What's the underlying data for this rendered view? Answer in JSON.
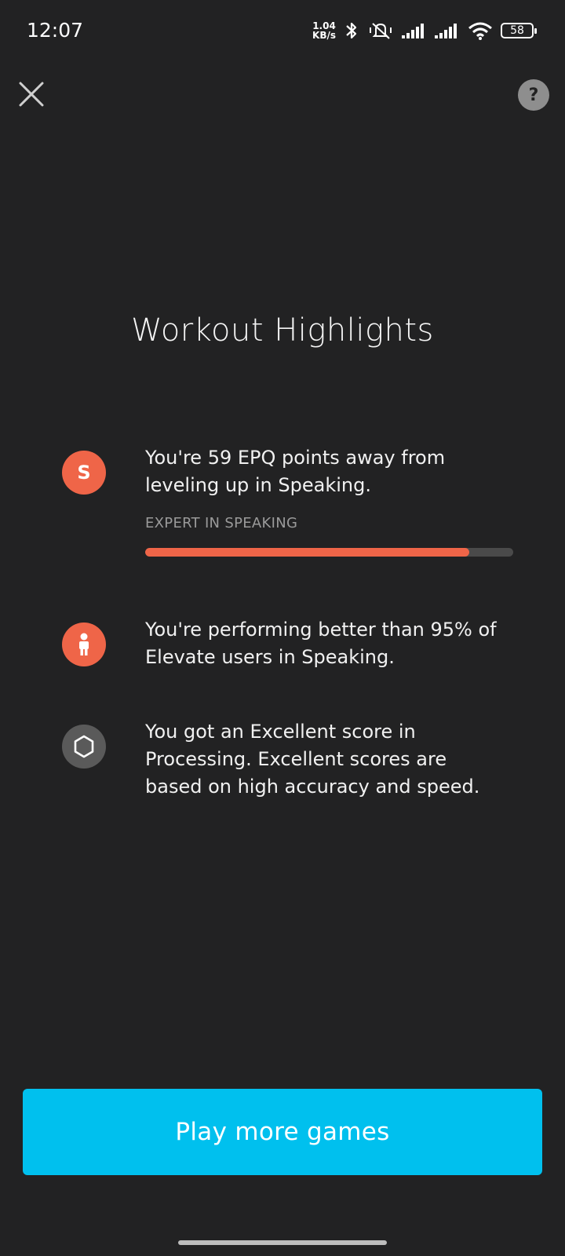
{
  "status_bar": {
    "time": "12:07",
    "net_speed_value": "1.04",
    "net_speed_unit": "KB/s",
    "battery": "58"
  },
  "header": {
    "help_label": "?"
  },
  "title": "Workout Highlights",
  "highlights": [
    {
      "icon": "speaking-s-badge-icon",
      "icon_letter": "S",
      "text_line1": "You're 59 EPQ points away from",
      "text_line2": "leveling up in Speaking.",
      "level_label": "EXPERT IN SPEAKING",
      "progress": 0.88
    },
    {
      "icon": "person-icon",
      "text_line1": "You're performing better than 95% of",
      "text_line2": "Elevate users in Speaking."
    },
    {
      "icon": "hexagon-icon",
      "text_line1": "You got an Excellent score in",
      "text_line2": "Processing. Excellent scores are",
      "text_line3": "based on high accuracy and speed."
    }
  ],
  "cta": {
    "label": "Play more games"
  },
  "colors": {
    "background": "#222223",
    "accent_orange": "#ef6548",
    "cta_blue": "#00c0ee",
    "neutral_grey": "#5a5a5a"
  }
}
